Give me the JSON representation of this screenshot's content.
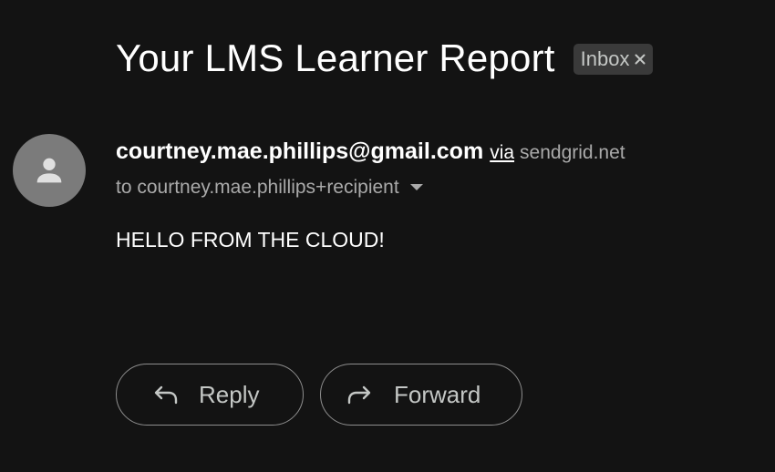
{
  "email": {
    "subject": "Your LMS Learner Report",
    "label_chip": {
      "label": "Inbox",
      "close_icon": "close-icon"
    },
    "sender": {
      "avatar_icon": "person-icon",
      "address": "courtney.mae.phillips@gmail.com",
      "via_label": "via",
      "via_domain": "sendgrid.net"
    },
    "recipient_line": "to courtney.mae.phillips+recipient",
    "recipient_details_icon": "caret-down-icon",
    "body": "HELLO FROM THE CLOUD!"
  },
  "actions": {
    "reply": {
      "label": "Reply",
      "icon": "reply-arrow-icon"
    },
    "forward": {
      "label": "Forward",
      "icon": "forward-arrow-icon"
    }
  },
  "colors": {
    "background": "#131313",
    "chip_background": "#3a3a3a",
    "avatar_background": "#7b7b7b",
    "secondary_text": "#aaaaaa",
    "button_border": "#8e8e8e"
  }
}
